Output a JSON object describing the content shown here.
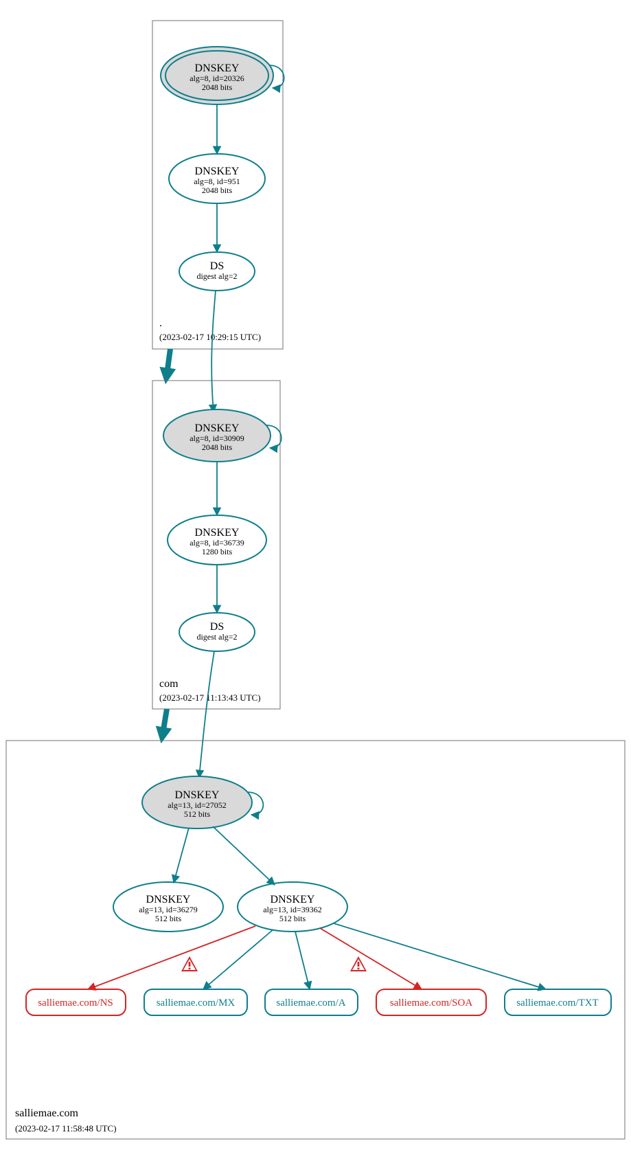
{
  "colors": {
    "teal": "#0e7e8b",
    "red": "#d42424",
    "grey": "#d9d9d9"
  },
  "zones": {
    "root": {
      "name": ".",
      "timestamp": "(2023-02-17 10:29:15 UTC)"
    },
    "com": {
      "name": "com",
      "timestamp": "(2023-02-17 11:13:43 UTC)"
    },
    "salliemae": {
      "name": "salliemae.com",
      "timestamp": "(2023-02-17 11:58:48 UTC)"
    }
  },
  "nodes": {
    "rootKSK": {
      "title": "DNSKEY",
      "line2": "alg=8, id=20326",
      "line3": "2048 bits"
    },
    "rootZSK": {
      "title": "DNSKEY",
      "line2": "alg=8, id=951",
      "line3": "2048 bits"
    },
    "rootDS": {
      "title": "DS",
      "line2": "digest alg=2"
    },
    "comKSK": {
      "title": "DNSKEY",
      "line2": "alg=8, id=30909",
      "line3": "2048 bits"
    },
    "comZSK": {
      "title": "DNSKEY",
      "line2": "alg=8, id=36739",
      "line3": "1280 bits"
    },
    "comDS": {
      "title": "DS",
      "line2": "digest alg=2"
    },
    "smKSK": {
      "title": "DNSKEY",
      "line2": "alg=13, id=27052",
      "line3": "512 bits"
    },
    "smZSK1": {
      "title": "DNSKEY",
      "line2": "alg=13, id=36279",
      "line3": "512 bits"
    },
    "smZSK2": {
      "title": "DNSKEY",
      "line2": "alg=13, id=39362",
      "line3": "512 bits"
    },
    "rr": {
      "ns": "salliemae.com/NS",
      "mx": "salliemae.com/MX",
      "a": "salliemae.com/A",
      "soa": "salliemae.com/SOA",
      "txt": "salliemae.com/TXT"
    }
  },
  "warnings": [
    {
      "between": [
        "smZSK2",
        "ns"
      ]
    },
    {
      "between": [
        "smZSK2",
        "soa"
      ]
    }
  ]
}
